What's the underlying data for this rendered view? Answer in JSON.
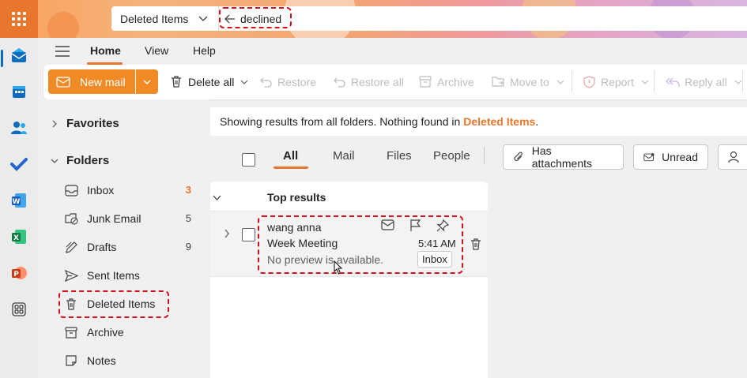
{
  "search": {
    "scope": "Deleted Items",
    "query": "declined"
  },
  "menu": {
    "tabs": [
      "Home",
      "View",
      "Help"
    ]
  },
  "ribbon": {
    "new_mail": "New mail",
    "delete_all": "Delete all",
    "restore": "Restore",
    "restore_all": "Restore all",
    "archive": "Archive",
    "move_to": "Move to",
    "report": "Report",
    "reply_all": "Reply all"
  },
  "folders": {
    "favorites": "Favorites",
    "folders": "Folders",
    "items": [
      {
        "label": "Inbox",
        "count": "3",
        "icon": "inbox-icon"
      },
      {
        "label": "Junk Email",
        "count": "5",
        "icon": "junk-icon"
      },
      {
        "label": "Drafts",
        "count": "9",
        "icon": "drafts-icon"
      },
      {
        "label": "Sent Items",
        "count": "",
        "icon": "send-icon"
      },
      {
        "label": "Deleted Items",
        "count": "",
        "icon": "trash-icon"
      },
      {
        "label": "Archive",
        "count": "",
        "icon": "archive-icon"
      },
      {
        "label": "Notes",
        "count": "",
        "icon": "notes-icon"
      }
    ]
  },
  "results": {
    "info_prefix": "Showing results from all folders. Nothing found in",
    "info_folder": "Deleted Items",
    "info_suffix": ".",
    "tabs": [
      "All",
      "Mail",
      "Files",
      "People"
    ],
    "filters": [
      "Has attachments",
      "Unread"
    ],
    "section": "Top results",
    "message": {
      "sender": "wang anna",
      "subject": "Week Meeting",
      "preview": "No preview is available.",
      "time": "5:41 AM",
      "folder": "Inbox"
    }
  },
  "colors": {
    "accent": "#e8762c",
    "highlight": "#d0111b",
    "link_blue": "#0f6cbd"
  }
}
